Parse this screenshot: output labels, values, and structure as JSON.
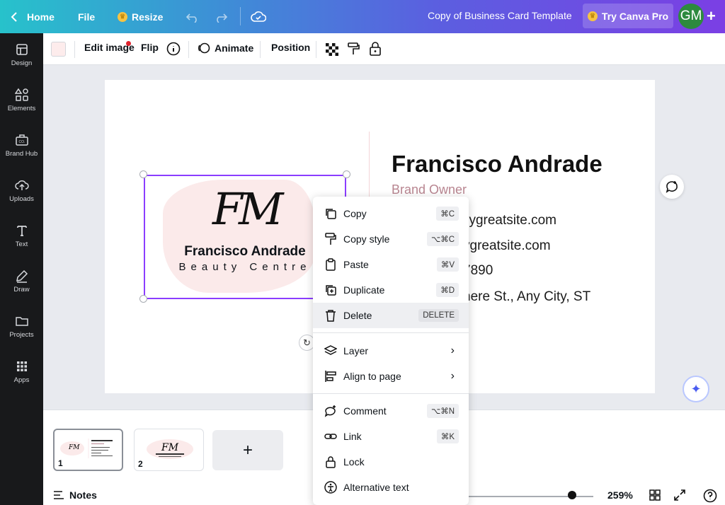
{
  "topbar": {
    "home": "Home",
    "file": "File",
    "resize": "Resize",
    "title": "Copy of Business Card Template",
    "try_pro": "Try Canva Pro",
    "avatar_initials": "GM"
  },
  "sidebar": {
    "items": [
      {
        "label": "Design",
        "icon": "design-icon"
      },
      {
        "label": "Elements",
        "icon": "elements-icon"
      },
      {
        "label": "Brand Hub",
        "icon": "brand-hub-icon"
      },
      {
        "label": "Uploads",
        "icon": "uploads-icon"
      },
      {
        "label": "Text",
        "icon": "text-icon"
      },
      {
        "label": "Draw",
        "icon": "draw-icon"
      },
      {
        "label": "Projects",
        "icon": "projects-icon"
      },
      {
        "label": "Apps",
        "icon": "apps-icon"
      }
    ]
  },
  "toolbar": {
    "edit_image": "Edit image",
    "flip": "Flip",
    "animate": "Animate",
    "position": "Position",
    "swatch_color": "#fdecec"
  },
  "card": {
    "monogram": "FM",
    "logo_name": "Francisco Andrade",
    "logo_tagline": "Beauty Centre",
    "name": "Francisco Andrade",
    "role": "Brand Owner",
    "info": [
      "llygreatsite.com",
      "ygreatsite.com",
      "7890",
      "here St., Any City, ST"
    ]
  },
  "menu": {
    "items": [
      {
        "label": "Copy",
        "shortcut": "⌘C",
        "icon": "copy-icon"
      },
      {
        "label": "Copy style",
        "shortcut": "⌥⌘C",
        "icon": "paint-roller-icon"
      },
      {
        "label": "Paste",
        "shortcut": "⌘V",
        "icon": "paste-icon"
      },
      {
        "label": "Duplicate",
        "shortcut": "⌘D",
        "icon": "duplicate-icon"
      },
      {
        "label": "Delete",
        "shortcut": "DELETE",
        "icon": "trash-icon"
      },
      {
        "label": "Layer",
        "icon": "layers-icon"
      },
      {
        "label": "Align to page",
        "icon": "align-icon"
      },
      {
        "label": "Comment",
        "shortcut": "⌥⌘N",
        "icon": "comment-icon"
      },
      {
        "label": "Link",
        "shortcut": "⌘K",
        "icon": "link-icon"
      },
      {
        "label": "Lock",
        "icon": "lock-icon"
      },
      {
        "label": "Alternative text",
        "icon": "alt-text-icon"
      }
    ]
  },
  "pages": {
    "thumbs": [
      {
        "number": "1"
      },
      {
        "number": "2"
      }
    ]
  },
  "bottombar": {
    "notes": "Notes",
    "zoom": "259%"
  }
}
